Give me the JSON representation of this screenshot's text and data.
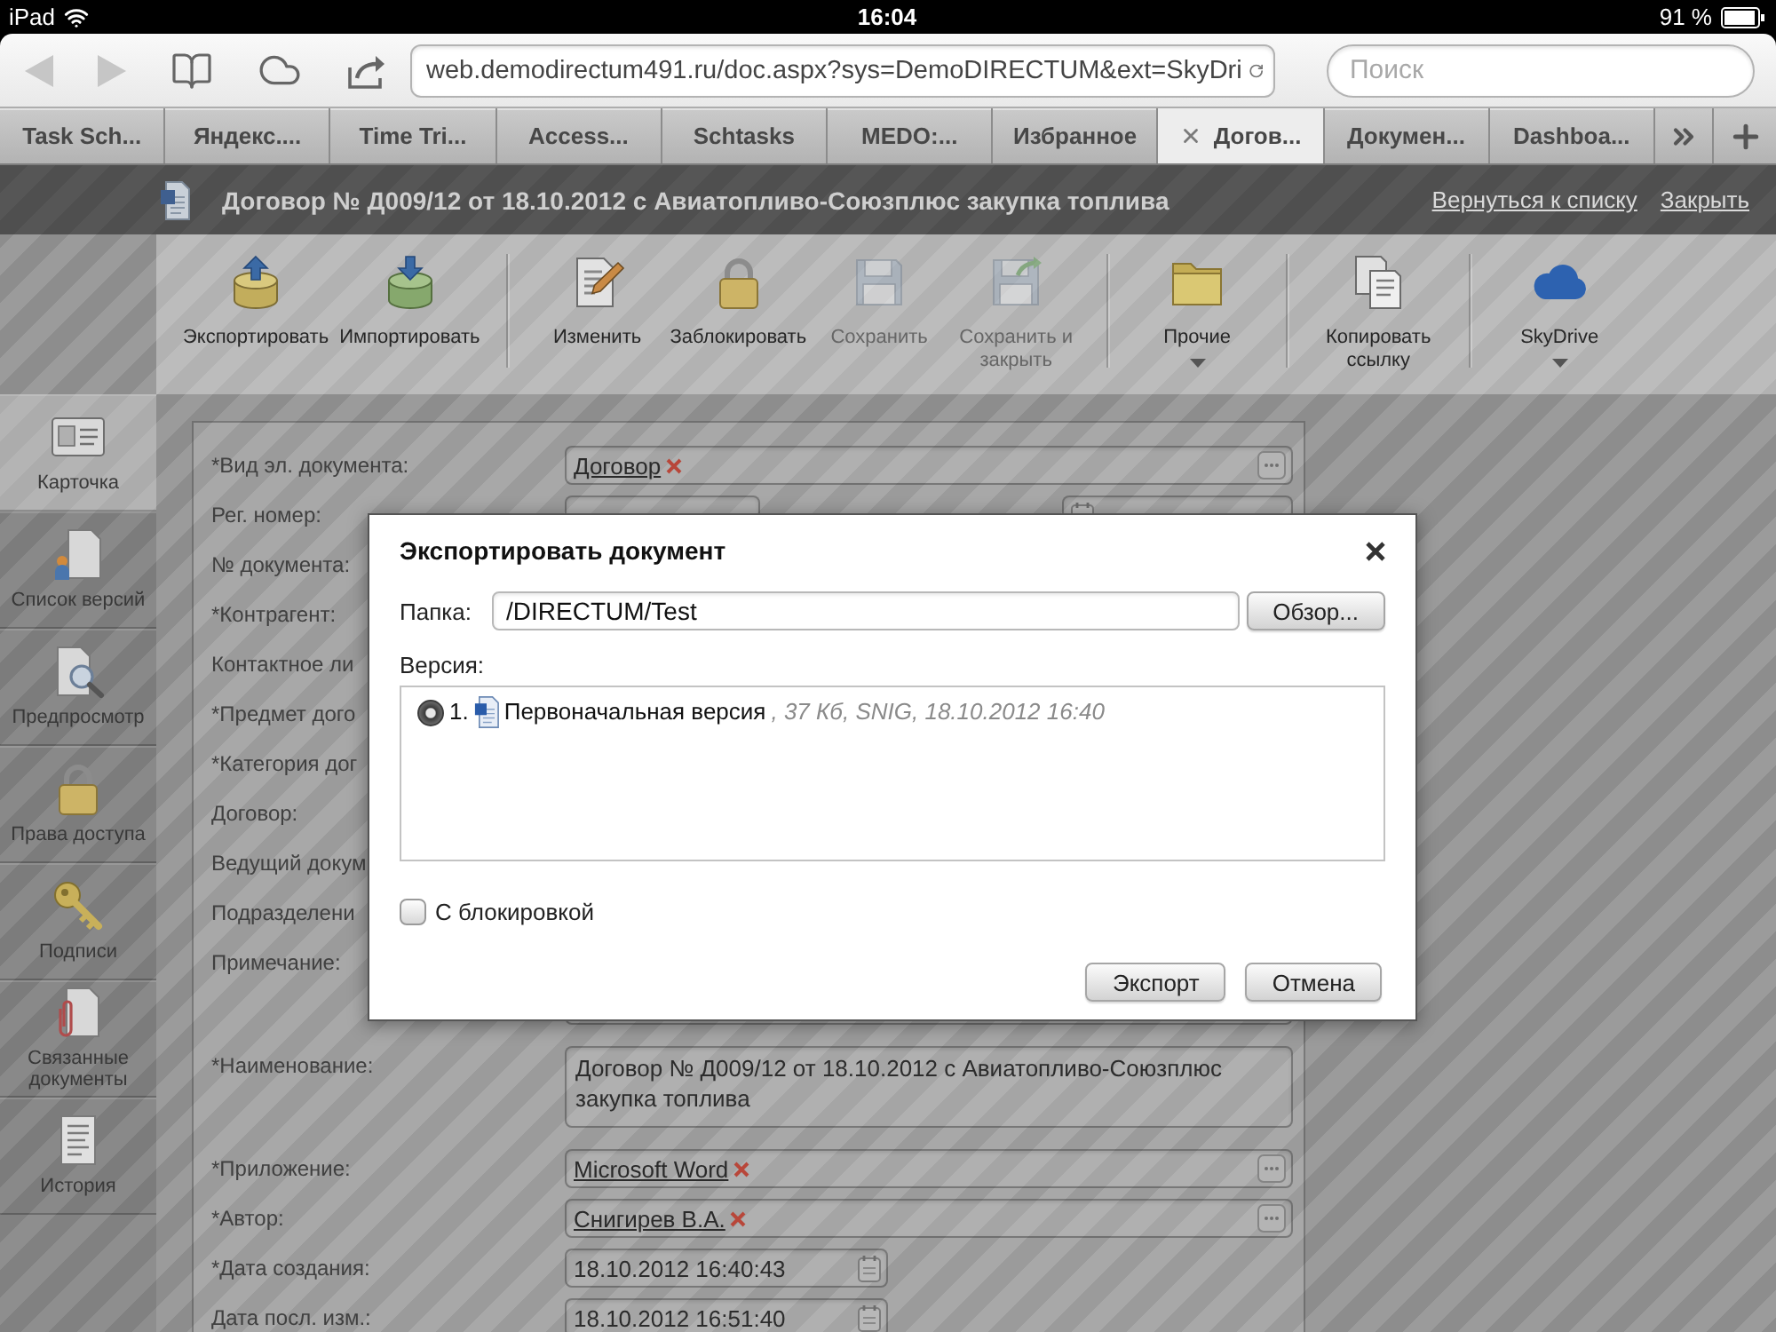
{
  "status_bar": {
    "device": "iPad",
    "time": "16:04",
    "battery": "91 %"
  },
  "browser": {
    "url": "web.demodirectum491.ru/doc.aspx?sys=DemoDIRECTUM&ext=SkyDri",
    "search": {
      "placeholder": "Поиск"
    },
    "tabs": [
      {
        "label": "Task Sch...",
        "selected": false
      },
      {
        "label": "Яндекс....",
        "selected": false
      },
      {
        "label": "Time Tri...",
        "selected": false
      },
      {
        "label": "Access...",
        "selected": false
      },
      {
        "label": "Schtasks",
        "selected": false
      },
      {
        "label": "MEDO:...",
        "selected": false
      },
      {
        "label": "Избранное",
        "selected": false
      },
      {
        "label": "Догов...",
        "selected": true
      },
      {
        "label": "Докумен...",
        "selected": false
      },
      {
        "label": "Dashboa...",
        "selected": false
      }
    ]
  },
  "document": {
    "title": "Договор № Д009/12 от 18.10.2012 с Авиатопливо-Союзплюс закупка топлива",
    "links": [
      "Вернуться к списку",
      "Закрыть"
    ]
  },
  "toolbar": {
    "groups": [
      [
        {
          "label": "Экспортировать",
          "disabled": false,
          "dropdown": false
        },
        {
          "label": "Импортировать",
          "disabled": false,
          "dropdown": false
        }
      ],
      [
        {
          "label": "Изменить",
          "disabled": false,
          "dropdown": false
        },
        {
          "label": "Заблокировать",
          "disabled": false,
          "dropdown": false
        },
        {
          "label": "Сохранить",
          "disabled": true,
          "dropdown": false
        },
        {
          "label": "Сохранить и закрыть",
          "disabled": true,
          "dropdown": false
        }
      ],
      [
        {
          "label": "Прочие",
          "disabled": false,
          "dropdown": true
        }
      ],
      [
        {
          "label": "Копировать ссылку",
          "disabled": false,
          "dropdown": false
        }
      ],
      [
        {
          "label": "SkyDrive",
          "disabled": false,
          "dropdown": true
        }
      ]
    ]
  },
  "sidebar": {
    "items": [
      {
        "label": "Карточка",
        "selected": true
      },
      {
        "label": "Список версий",
        "selected": false
      },
      {
        "label": "Предпросмотр",
        "selected": false
      },
      {
        "label": "Права доступа",
        "selected": false
      },
      {
        "label": "Подписи",
        "selected": false
      },
      {
        "label": "Связанные документы",
        "selected": false
      },
      {
        "label": "История",
        "selected": false
      }
    ]
  },
  "form": {
    "rows": [
      {
        "label": "*Вид эл. документа:",
        "fields": [
          {
            "kind": "reference",
            "value": "Договор"
          }
        ]
      },
      {
        "label": "Рег. номер:",
        "fields": [
          {
            "kind": "text"
          },
          {
            "kind": "date"
          }
        ]
      },
      {
        "label": "№ документа:"
      },
      {
        "label": "*Контрагент:"
      },
      {
        "label": "Контактное ли"
      },
      {
        "label": "*Предмет дого"
      },
      {
        "label": "*Категория дог"
      },
      {
        "label": "Договор:"
      },
      {
        "label": "Ведущий докум"
      },
      {
        "label": "Подразделени"
      },
      {
        "label": "Примечание:",
        "fields": [
          {
            "kind": "textarea"
          }
        ]
      },
      {
        "label": "*Наименование:",
        "fields": [
          {
            "kind": "textarea",
            "value": "Договор № Д009/12 от 18.10.2012 с Авиатопливо-Союзплюс закупка топлива"
          }
        ]
      },
      {
        "label": "*Приложение:",
        "fields": [
          {
            "kind": "reference",
            "value": "Microsoft Word"
          }
        ]
      },
      {
        "label": "*Автор:",
        "fields": [
          {
            "kind": "reference",
            "value": "Снигирев В.А."
          }
        ]
      },
      {
        "label": "*Дата создания:",
        "fields": [
          {
            "kind": "date",
            "value": "18.10.2012 16:40:43"
          }
        ]
      },
      {
        "label": "Дата посл. изм.:",
        "fields": [
          {
            "kind": "date",
            "value": "18.10.2012 16:51:40"
          }
        ]
      }
    ]
  },
  "dialog": {
    "title": "Экспортировать документ",
    "folder": {
      "label": "Папка:",
      "value": "/DIRECTUM/Test",
      "button": "Обзор..."
    },
    "version": {
      "label": "Версия:",
      "items": [
        {
          "number": "1.",
          "name": "Первоначальная версия",
          "details": ", 37 Кб, SNIG, 18.10.2012 16:40",
          "selected": true
        }
      ]
    },
    "lock": {
      "label": "С блокировкой",
      "checked": false
    },
    "buttons": [
      "Экспорт",
      "Отмена"
    ]
  }
}
